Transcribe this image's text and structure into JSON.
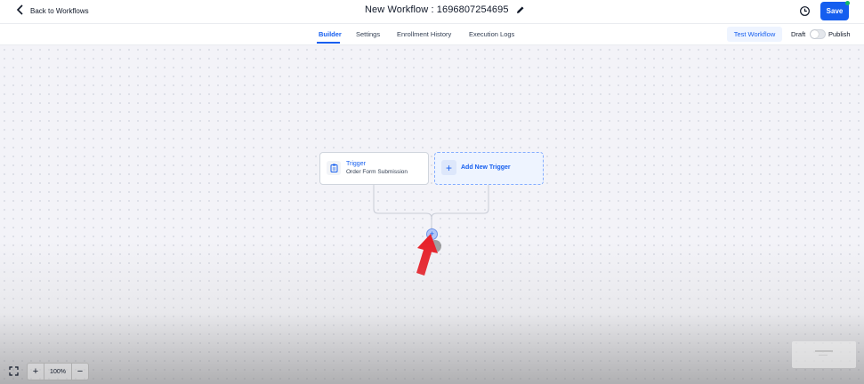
{
  "header": {
    "back_label": "Back to Workflows",
    "title": "New Workflow : 1696807254695",
    "save_label": "Save"
  },
  "tabs": [
    {
      "label": "Builder",
      "active": true
    },
    {
      "label": "Settings",
      "active": false
    },
    {
      "label": "Enrollment History",
      "active": false
    },
    {
      "label": "Execution Logs",
      "active": false
    }
  ],
  "actions": {
    "test_workflow_label": "Test Workflow",
    "draft_label": "Draft",
    "publish_label": "Publish",
    "published": false
  },
  "canvas": {
    "trigger": {
      "title": "Trigger",
      "subtitle": "Order Form Submission"
    },
    "add_trigger_label": "Add New Trigger",
    "add_step_symbol": "+"
  },
  "zoom": {
    "level": "100%",
    "zoom_in": "+",
    "zoom_out": "−"
  },
  "colors": {
    "accent": "#155eef",
    "status_online": "#12b76a",
    "annotation_arrow": "#e8212a"
  },
  "icons": [
    "back-arrow-icon",
    "pencil-icon",
    "history-icon",
    "clipboard-icon",
    "plus-icon",
    "fit-view-icon"
  ]
}
